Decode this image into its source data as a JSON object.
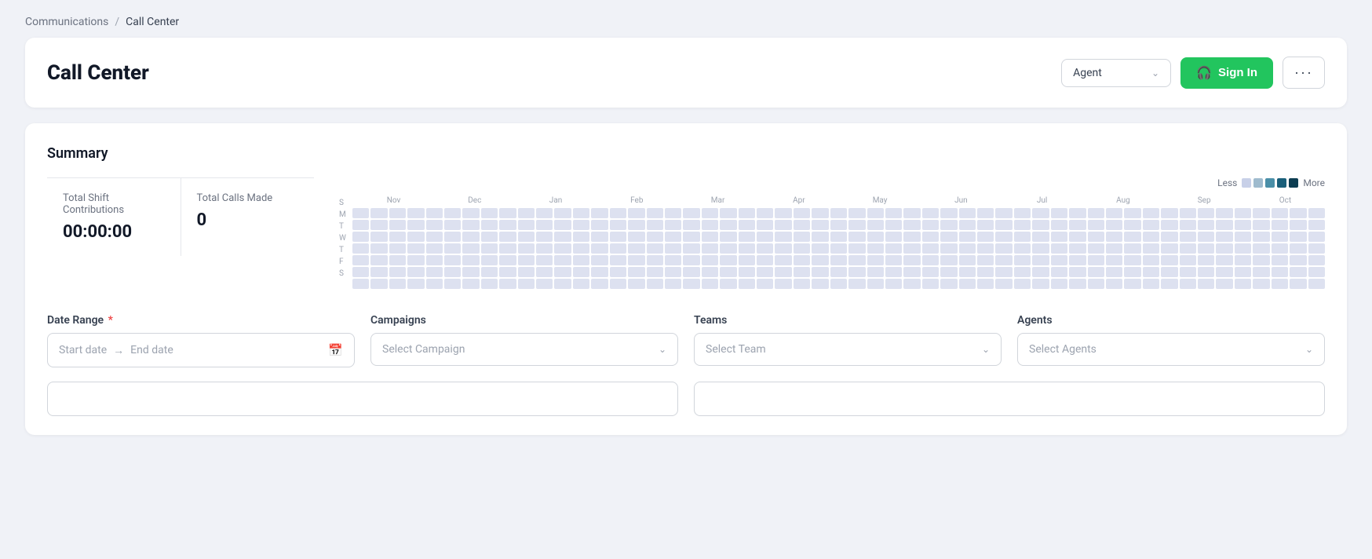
{
  "breadcrumb": {
    "parent": "Communications",
    "separator": "/",
    "current": "Call Center"
  },
  "header": {
    "title": "Call Center",
    "agent_dropdown": {
      "label": "Agent",
      "placeholder": "Agent"
    },
    "sign_in_button": "Sign In",
    "more_button": "···"
  },
  "summary": {
    "section_label": "Summary",
    "stats": {
      "total_shift_label": "Total Shift Contributions",
      "total_shift_value": "00:00:00",
      "total_calls_label": "Total Calls Made",
      "total_calls_value": "0"
    },
    "heatmap": {
      "legend_less": "Less",
      "legend_more": "More",
      "day_labels": [
        "S",
        "M",
        "T",
        "W",
        "T",
        "F",
        "S"
      ],
      "month_labels": [
        "Nov",
        "Dec",
        "Jan",
        "Feb",
        "Mar",
        "Apr",
        "May",
        "Jun",
        "Jul",
        "Aug",
        "Sep",
        "Oct"
      ]
    }
  },
  "filters": {
    "date_range": {
      "label": "Date Range",
      "required": true,
      "start_placeholder": "Start date",
      "end_placeholder": "End date"
    },
    "campaigns": {
      "label": "Campaigns",
      "placeholder": "Select Campaign"
    },
    "teams": {
      "label": "Teams",
      "placeholder": "Select Team"
    },
    "agents": {
      "label": "Agents",
      "placeholder": "Select Agents"
    }
  },
  "colors": {
    "accent_green": "#22c55e",
    "heatmap_base": "#dde1f0",
    "heatmap_l1": "#9fbbce",
    "heatmap_l2": "#4a8fa8",
    "heatmap_l3": "#1a5f7a",
    "heatmap_l4": "#0d3d52"
  }
}
